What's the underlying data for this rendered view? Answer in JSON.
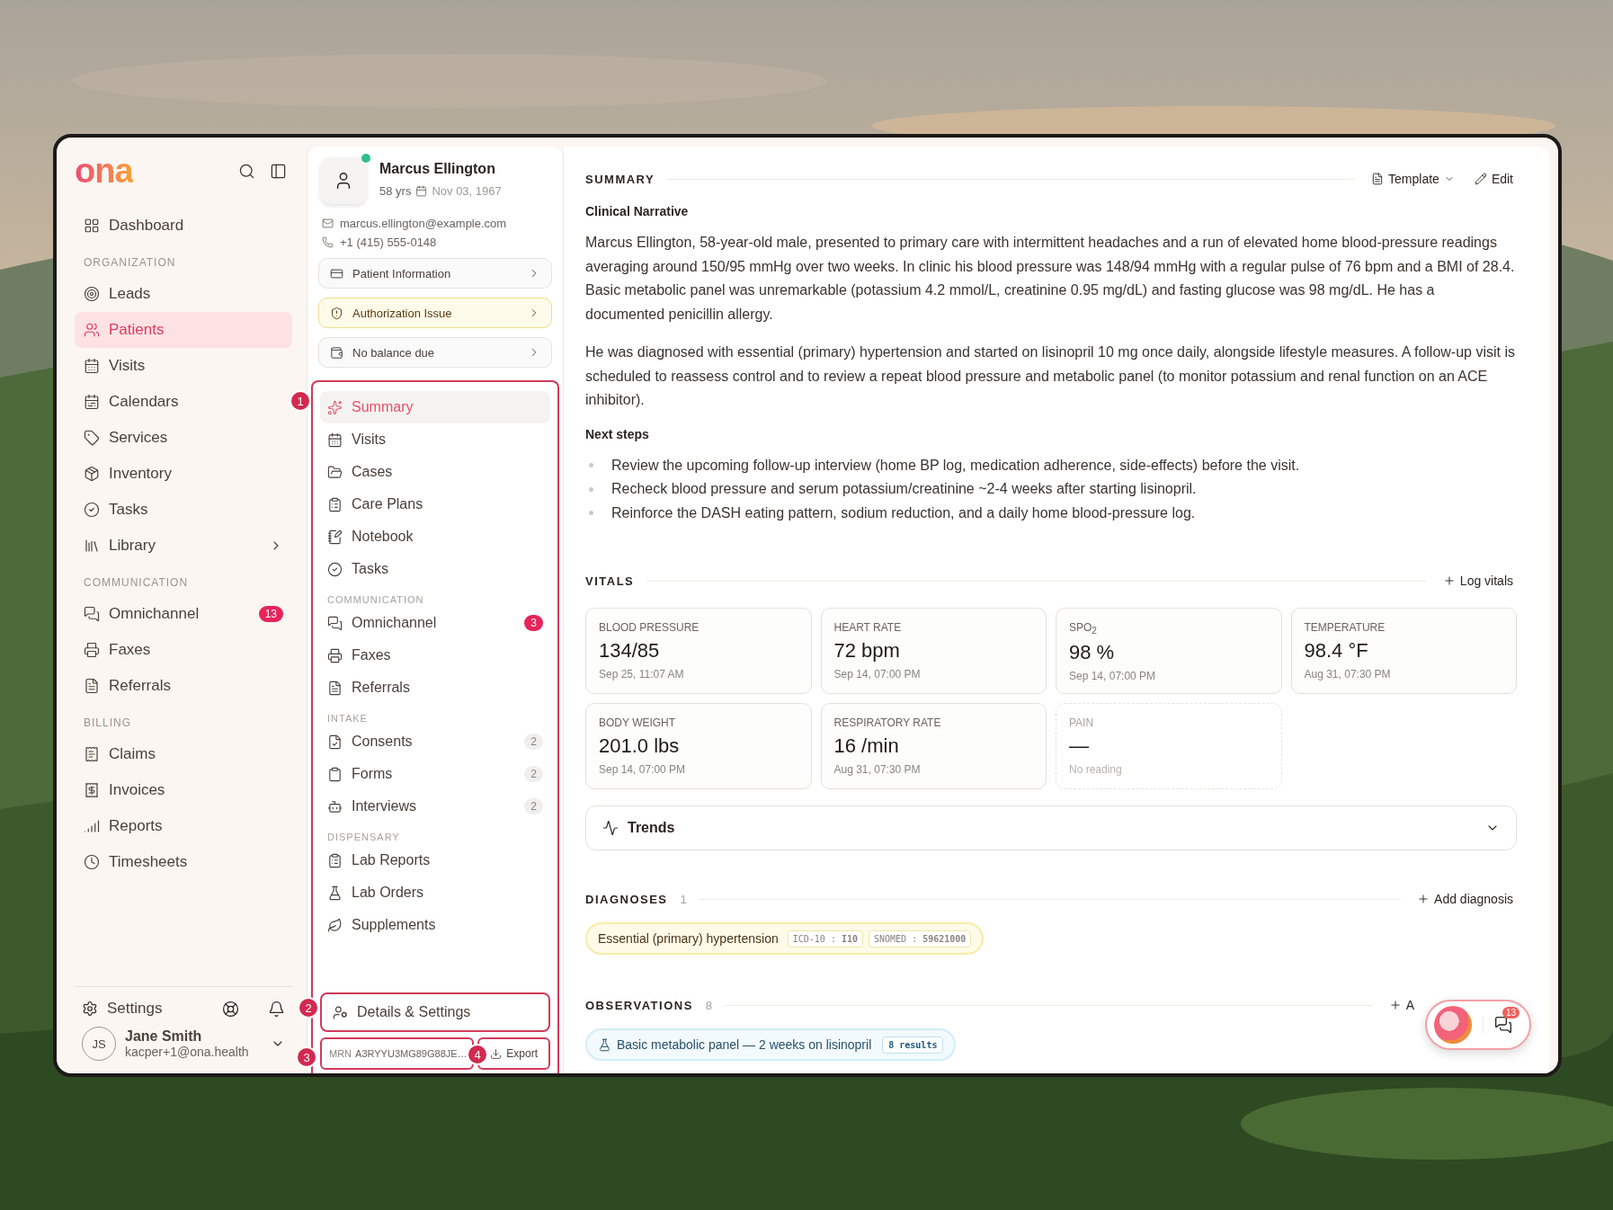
{
  "logo": "ona",
  "sidebar": {
    "groups": [
      {
        "items": [
          {
            "label": "Dashboard",
            "selected": false
          }
        ]
      },
      {
        "title": "ORGANIZATION",
        "items": [
          {
            "label": "Leads",
            "selected": false
          },
          {
            "label": "Patients",
            "selected": true
          },
          {
            "label": "Visits",
            "selected": false
          },
          {
            "label": "Calendars",
            "selected": false
          },
          {
            "label": "Services",
            "selected": false
          },
          {
            "label": "Inventory",
            "selected": false
          },
          {
            "label": "Tasks",
            "selected": false
          },
          {
            "label": "Library",
            "selected": false,
            "submenu": true
          }
        ]
      },
      {
        "title": "COMMUNICATION",
        "items": [
          {
            "label": "Omnichannel",
            "selected": false,
            "badge": "13"
          },
          {
            "label": "Faxes",
            "selected": false
          },
          {
            "label": "Referrals",
            "selected": false
          }
        ]
      },
      {
        "title": "BILLING",
        "items": [
          {
            "label": "Claims",
            "selected": false
          },
          {
            "label": "Invoices",
            "selected": false
          },
          {
            "label": "Reports",
            "selected": false
          },
          {
            "label": "Timesheets",
            "selected": false
          }
        ]
      }
    ],
    "settings": "Settings",
    "user": {
      "initials": "JS",
      "name": "Jane Smith",
      "email": "kacper+1@ona.health"
    }
  },
  "patient": {
    "name": "Marcus Ellington",
    "online": true,
    "age": "58 yrs",
    "dob": "Nov 03, 1967",
    "email": "marcus.ellington@example.com",
    "phone": "+1 (415) 555-0148",
    "cards": [
      {
        "label": "Patient Information",
        "kind": "info"
      },
      {
        "label": "Authorization Issue",
        "kind": "warning"
      },
      {
        "label": "No balance due",
        "kind": "balance"
      }
    ],
    "nav_outlined": true,
    "nav": [
      {
        "items": [
          {
            "label": "Summary",
            "selected": true
          },
          {
            "label": "Visits",
            "selected": false
          },
          {
            "label": "Cases",
            "selected": false
          },
          {
            "label": "Care Plans",
            "selected": false
          },
          {
            "label": "Notebook",
            "selected": false
          },
          {
            "label": "Tasks",
            "selected": false
          }
        ]
      },
      {
        "title": "COMMUNICATION",
        "items": [
          {
            "label": "Omnichannel",
            "selected": false,
            "badge": {
              "text": "3",
              "kind": "alert"
            }
          },
          {
            "label": "Faxes",
            "selected": false
          },
          {
            "label": "Referrals",
            "selected": false
          }
        ]
      },
      {
        "title": "INTAKE",
        "items": [
          {
            "label": "Consents",
            "selected": false,
            "badge": {
              "text": "2",
              "kind": "count"
            }
          },
          {
            "label": "Forms",
            "selected": false,
            "badge": {
              "text": "2",
              "kind": "count"
            }
          },
          {
            "label": "Interviews",
            "selected": false,
            "badge": {
              "text": "2",
              "kind": "count"
            }
          }
        ]
      },
      {
        "title": "DISPENSARY",
        "items": [
          {
            "label": "Lab Reports",
            "selected": false
          },
          {
            "label": "Lab Orders",
            "selected": false
          },
          {
            "label": "Supplements",
            "selected": false
          }
        ]
      }
    ],
    "details": {
      "label": "Details & Settings",
      "outlined": true
    },
    "mrn": {
      "label": "MRN",
      "value": "A3RYYU3MG89G88JE…",
      "outlined": true
    },
    "export": {
      "label": "Export",
      "outlined": true
    }
  },
  "summary": {
    "title": "SUMMARY",
    "template": "Template",
    "edit": "Edit",
    "heading": "Clinical Narrative",
    "paragraphs": [
      "Marcus Ellington, 58-year-old male, presented to primary care with intermittent headaches and a run of elevated home blood-pressure readings averaging around 150/95 mmHg over two weeks. In clinic his blood pressure was 148/94 mmHg with a regular pulse of 76 bpm and a BMI of 28.4. Basic metabolic panel was unremarkable (potassium 4.2 mmol/L, creatinine 0.95 mg/dL) and fasting glucose was 98 mg/dL. He has a documented penicillin allergy.",
      "He was diagnosed with essential (primary) hypertension and started on lisinopril 10 mg once daily, alongside lifestyle measures. A follow-up visit is scheduled to reassess control and to review a repeat blood pressure and metabolic panel (to monitor potassium and renal function on an ACE inhibitor)."
    ],
    "next_heading": "Next steps",
    "next_steps": [
      "Review the upcoming follow-up interview (home BP log, medication adherence, side-effects) before the visit.",
      "Recheck blood pressure and serum potassium/creatinine ~2-4 weeks after starting lisinopril.",
      "Reinforce the DASH eating pattern, sodium reduction, and a daily home blood-pressure log."
    ]
  },
  "vitals": {
    "title": "VITALS",
    "action": "Log vitals",
    "cards": [
      {
        "label": "BLOOD PRESSURE",
        "value": "134/85",
        "time": "Sep 25, 11:07 AM",
        "kind": "reading"
      },
      {
        "label": "HEART RATE",
        "value": "72 bpm",
        "time": "Sep 14, 07:00 PM",
        "kind": "reading"
      },
      {
        "label": "SPO$_{2}$",
        "value": "98 %",
        "time": "Sep 14, 07:00 PM",
        "kind": "reading"
      },
      {
        "label": "TEMPERATURE",
        "value": "98.4 °F",
        "time": "Aug 31, 07:30 PM",
        "kind": "reading"
      },
      {
        "label": "BODY WEIGHT",
        "value": "201.0 lbs",
        "time": "Sep 14, 07:00 PM",
        "kind": "reading"
      },
      {
        "label": "RESPIRATORY RATE",
        "value": "16 /min",
        "time": "Aug 31, 07:30 PM",
        "kind": "reading"
      },
      {
        "label": "PAIN",
        "value": "—",
        "time": "No reading",
        "kind": "empty"
      }
    ],
    "trends": {
      "label": "Trends",
      "expanded": false
    }
  },
  "diagnoses": {
    "title": "DIAGNOSES",
    "count": "1",
    "action": "Add diagnosis",
    "items": [
      {
        "name": "Essential (primary) hypertension",
        "codes": [
          "ICD-10 : **I10**",
          "SNOMED : **59621000**"
        ]
      }
    ]
  },
  "observations": {
    "title": "OBSERVATIONS",
    "count": "8",
    "action": "A",
    "items": [
      {
        "name": "Basic metabolic panel — 2 weeks on lisinopril",
        "results": "8 results"
      }
    ]
  },
  "chat_widget": {
    "badge": "13"
  },
  "annotations": [
    "1",
    "2",
    "3",
    "4"
  ]
}
